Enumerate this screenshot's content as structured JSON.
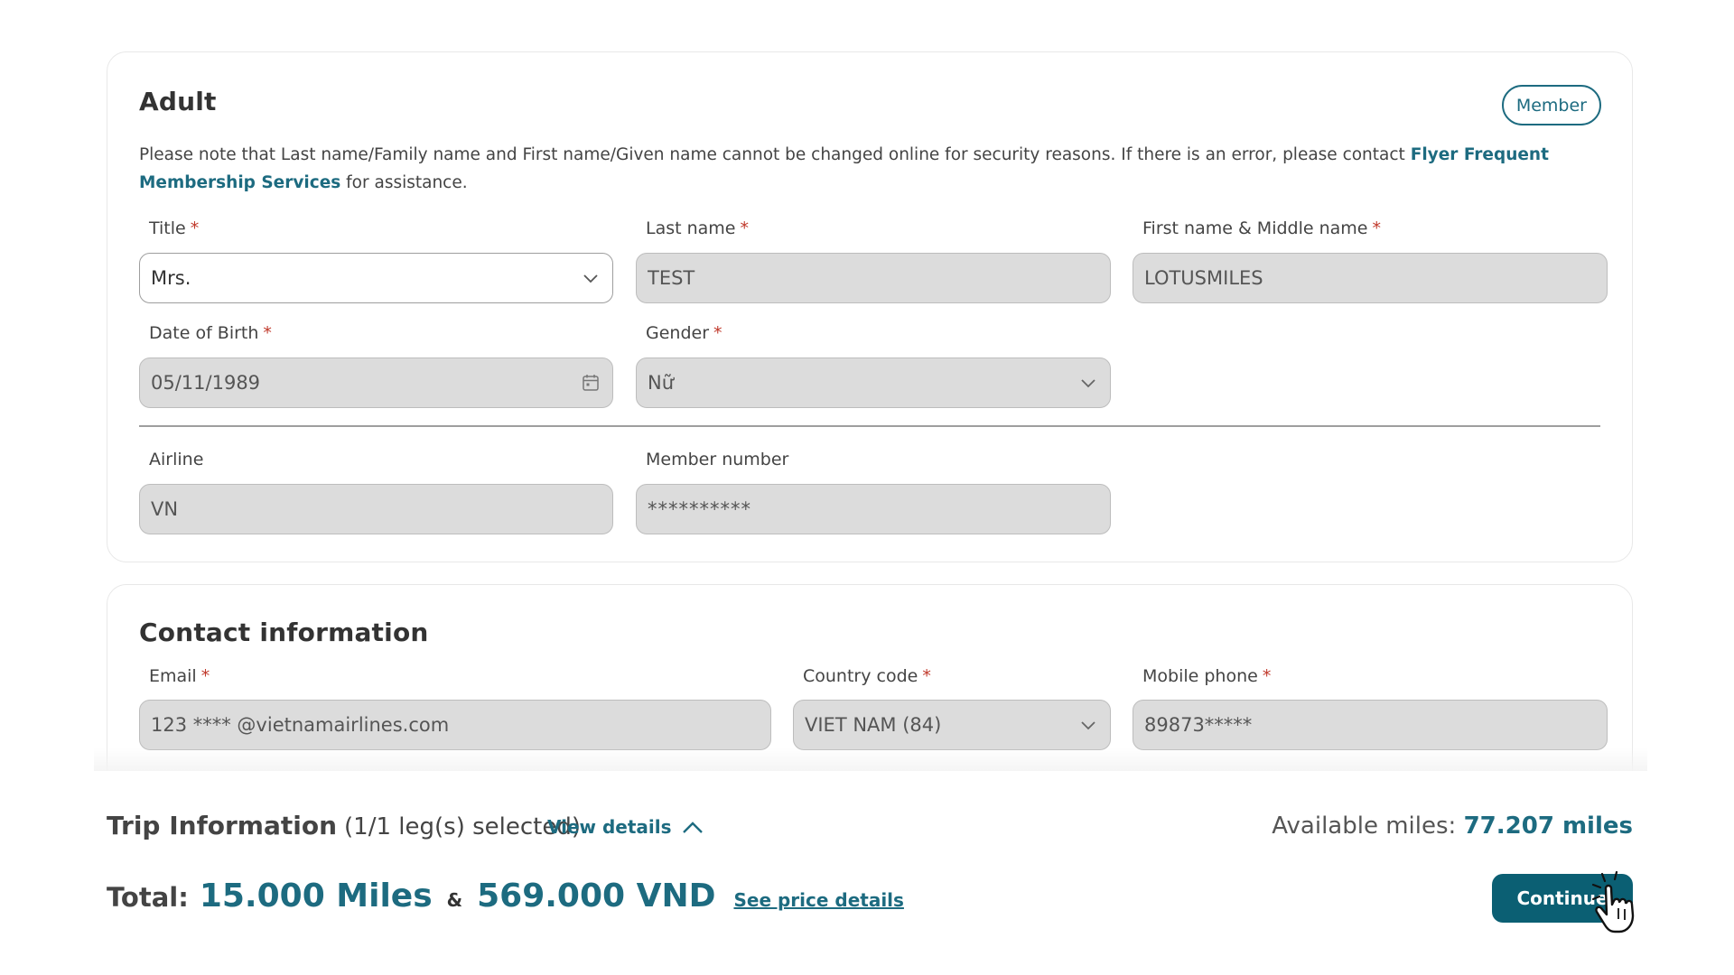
{
  "adult": {
    "title": "Adult",
    "member_badge": "Member",
    "notice_text": "Please note that Last name/Family name and First name/Given name cannot be changed online for security reasons. If there is an error, please contact ",
    "notice_link": "Flyer Frequent Membership Services",
    "notice_suffix": " for assistance.",
    "title_field": {
      "label": "Title",
      "value": "Mrs."
    },
    "last_name": {
      "label": "Last name",
      "value": "TEST"
    },
    "first_name": {
      "label": "First name & Middle name",
      "value": "LOTUSMILES"
    },
    "dob": {
      "label": "Date of Birth",
      "value": "05/11/1989"
    },
    "gender": {
      "label": "Gender",
      "value": "Nữ"
    },
    "airline": {
      "label": "Airline",
      "value": "VN"
    },
    "member_number": {
      "label": "Member number",
      "value": "**********"
    },
    "required_mark": "*"
  },
  "contact": {
    "title": "Contact information",
    "email": {
      "label": "Email",
      "value": "123 **** @vietnamairlines.com"
    },
    "country_code": {
      "label": "Country code",
      "value": "VIET NAM (84)"
    },
    "mobile": {
      "label": "Mobile phone",
      "value": "89873*****"
    }
  },
  "footer": {
    "trip_title": "Trip Information",
    "trip_sub": "(1/1 leg(s) selected)",
    "view_details": "View details",
    "available_label": "Available miles: ",
    "available_value": "77.207 miles",
    "total_label": "Total:",
    "total_miles": "15.000 Miles",
    "amp": "&",
    "total_vnd": "569.000 VND",
    "price_details": "See price details",
    "continue": "Continue"
  },
  "icons": {
    "dropdown": "chevron-down-icon",
    "calendar": "calendar-icon",
    "collapse": "chevron-up-icon",
    "pointer": "hand-pointer-cursor"
  },
  "colors": {
    "accent": "#1d6b80",
    "button": "#0b5f73",
    "disabled_field": "#dcdcdc",
    "required": "#c0392b"
  }
}
